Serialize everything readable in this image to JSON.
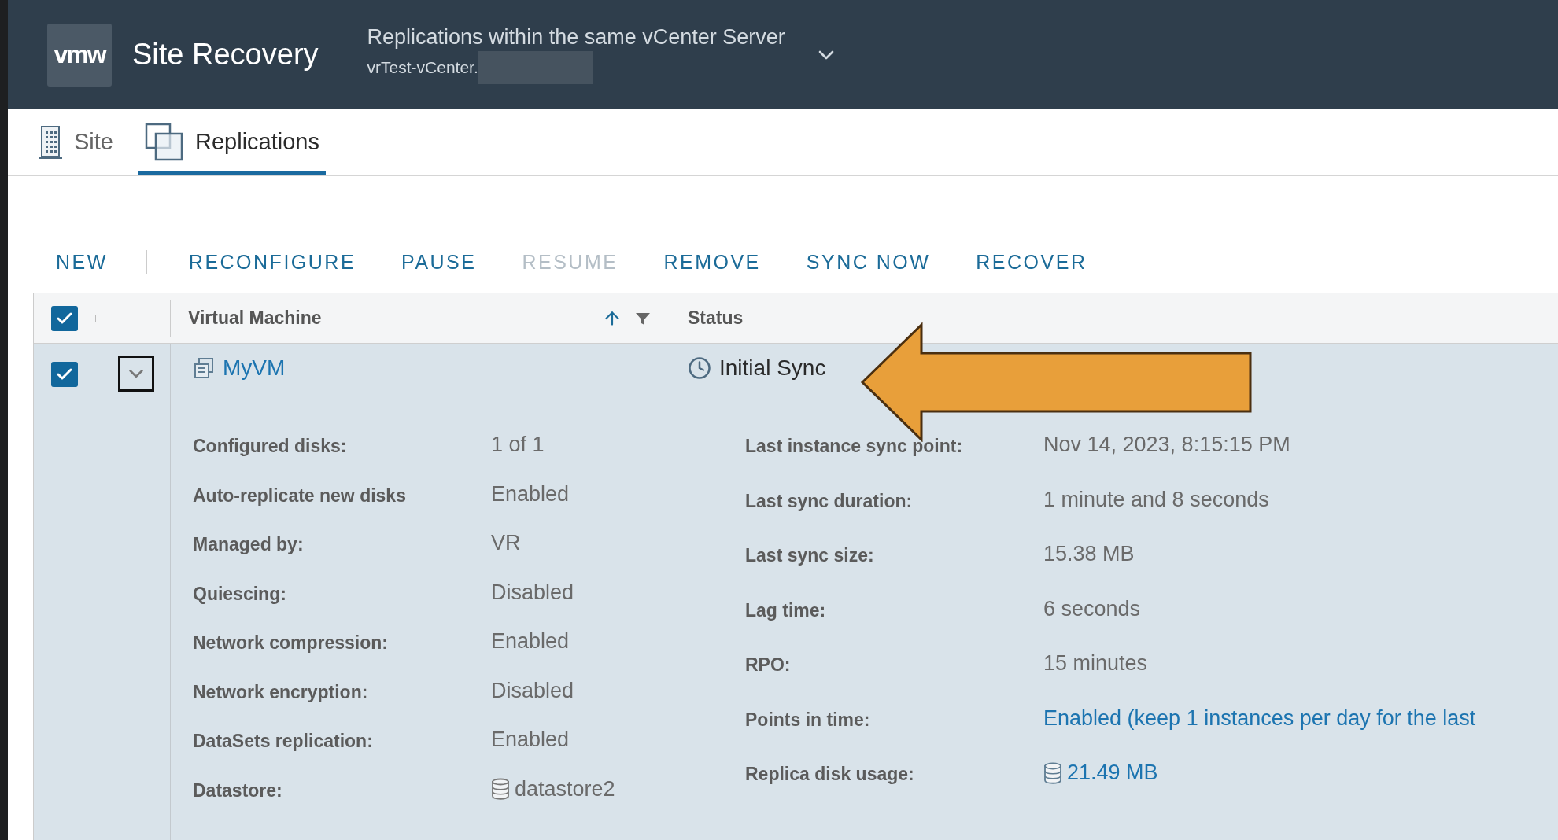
{
  "header": {
    "logo": "vmw",
    "title": "Site Recovery",
    "context": {
      "title": "Replications within the same vCenter Server",
      "subtitle": "vrTest-vCenter."
    }
  },
  "tabs": [
    {
      "label": "Site",
      "kind": "building",
      "selected": false
    },
    {
      "label": "Replications",
      "kind": "replications",
      "selected": true
    }
  ],
  "toolbar": {
    "primary": [
      {
        "label": "NEW",
        "disabled": false
      }
    ],
    "actions": [
      {
        "label": "RECONFIGURE",
        "disabled": false
      },
      {
        "label": "PAUSE",
        "disabled": false
      },
      {
        "label": "RESUME",
        "disabled": true
      },
      {
        "label": "REMOVE",
        "disabled": false
      },
      {
        "label": "SYNC NOW",
        "disabled": false
      },
      {
        "label": "RECOVER",
        "disabled": false
      }
    ]
  },
  "table": {
    "select_all": {
      "checked": true
    },
    "columns": [
      {
        "label": "Virtual Machine",
        "sorted": true,
        "filter": true
      },
      {
        "label": "Status",
        "sorted": false,
        "filter": false
      }
    ],
    "rows": [
      {
        "checked": true,
        "expanded": true,
        "vm": "MyVM",
        "status": "Initial Sync",
        "details_left": [
          {
            "label": "Configured disks:",
            "value": "1 of 1",
            "kind": "text"
          },
          {
            "label": "Auto-replicate new disks",
            "value": "Enabled",
            "kind": "text"
          },
          {
            "label": "Managed by:",
            "value": "VR",
            "kind": "text"
          },
          {
            "label": "Quiescing:",
            "value": "Disabled",
            "kind": "text"
          },
          {
            "label": "Network compression:",
            "value": "Enabled",
            "kind": "text"
          },
          {
            "label": "Network encryption:",
            "value": "Disabled",
            "kind": "text"
          },
          {
            "label": "DataSets replication:",
            "value": "Enabled",
            "kind": "text"
          },
          {
            "label": "Datastore:",
            "value": "datastore2",
            "kind": "storage"
          }
        ],
        "details_right": [
          {
            "label": "Last instance sync point:",
            "value": "Nov 14, 2023, 8:15:15 PM",
            "kind": "text"
          },
          {
            "label": "Last sync duration:",
            "value": "1 minute and 8 seconds",
            "kind": "text"
          },
          {
            "label": "Last sync size:",
            "value": "15.38 MB",
            "kind": "text"
          },
          {
            "label": "Lag time:",
            "value": "6 seconds",
            "kind": "text"
          },
          {
            "label": "RPO:",
            "value": "15 minutes",
            "kind": "text"
          },
          {
            "label": "Points in time:",
            "value": "Enabled (keep 1 instances per day for the last",
            "kind": "link"
          },
          {
            "label": "Replica disk usage:",
            "value": "21.49 MB",
            "kind": "storage-link"
          }
        ]
      }
    ]
  }
}
